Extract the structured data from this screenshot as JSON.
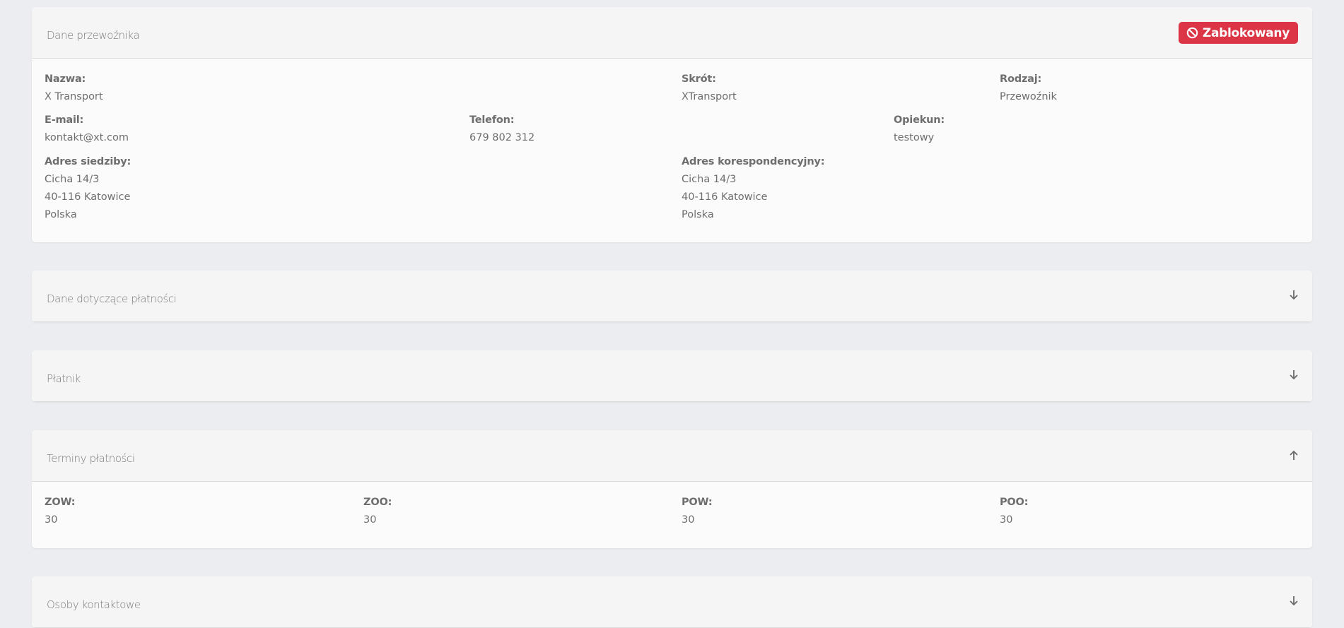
{
  "carrier": {
    "title": "Dane przewoźnika",
    "status_badge": "Zablokowany",
    "status_color": "#dc3545",
    "name_label": "Nazwa:",
    "name_value": "X Transport",
    "short_label": "Skrót:",
    "short_value": "XTransport",
    "type_label": "Rodzaj:",
    "type_value": "Przewoźnik",
    "email_label": "E-mail:",
    "email_value": "kontakt@xt.com",
    "phone_label": "Telefon:",
    "phone_value": "679 802 312",
    "keeper_label": "Opiekun:",
    "keeper_value": "testowy",
    "hq_label": "Adres siedziby:",
    "hq_lines": [
      "Cicha 14/3",
      "40-116 Katowice",
      "Polska"
    ],
    "corr_label": "Adres korespondencyjny:",
    "corr_lines": [
      "Cicha 14/3",
      "40-116 Katowice",
      "Polska"
    ]
  },
  "payment_data": {
    "title": "Dane dotyczące płatności",
    "expanded": false
  },
  "payer": {
    "title": "Płatnik",
    "expanded": false
  },
  "payment_terms": {
    "title": "Terminy płatności",
    "expanded": true,
    "items": [
      {
        "label": "ZOW:",
        "value": "30"
      },
      {
        "label": "ZOO:",
        "value": "30"
      },
      {
        "label": "POW:",
        "value": "30"
      },
      {
        "label": "POO:",
        "value": "30"
      }
    ]
  },
  "contacts": {
    "title": "Osoby kontaktowe",
    "expanded": false
  }
}
